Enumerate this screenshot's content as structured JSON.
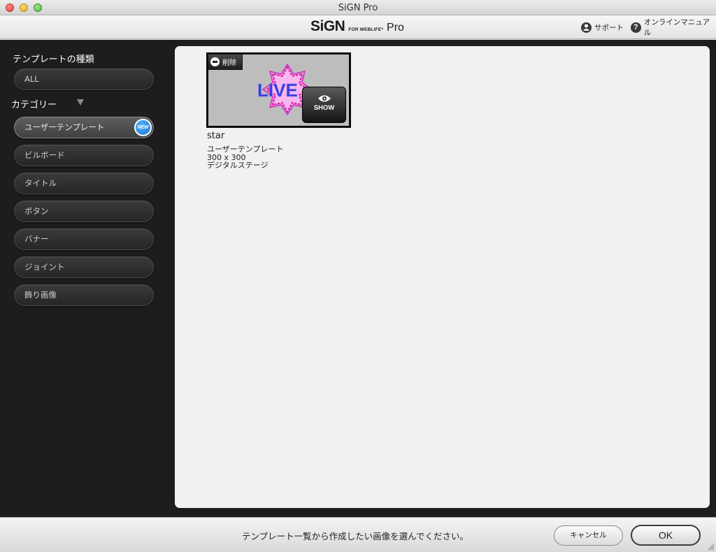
{
  "window": {
    "title": "SiGN Pro"
  },
  "header": {
    "logo_main": "SiGN",
    "logo_for": "FOR WEBLIFE*",
    "logo_pro": "Pro",
    "support_label": "サポート",
    "manual_label": "オンラインマニュアル"
  },
  "sidebar": {
    "types_title": "テンプレートの種類",
    "all_label": "ALL",
    "category_title": "カテゴリー",
    "categories": [
      {
        "label": "ユーザーテンプレート",
        "badge": "NEW"
      },
      {
        "label": "ビルボード"
      },
      {
        "label": "タイトル"
      },
      {
        "label": "ボタン"
      },
      {
        "label": "バナー"
      },
      {
        "label": "ジョイント"
      },
      {
        "label": "飾り画像"
      }
    ]
  },
  "templates": [
    {
      "delete_label": "削除",
      "show_label": "SHOW",
      "thumb_text": "LIVE",
      "name": "star",
      "category": "ユーザーテンプレート",
      "size": "300 x 300",
      "stage": "デジタルステージ"
    }
  ],
  "footer": {
    "message": "テンプレート一覧から作成したい画像を選んでください。",
    "cancel_label": "キャンセル",
    "ok_label": "OK"
  },
  "colors": {
    "sidebar_bg": "#1d1d1d",
    "content_bg": "#f1f1f1",
    "badge_blue": "#1a6fd0",
    "star_pink": "#e040c8",
    "live_blue": "#3b3bd8"
  }
}
